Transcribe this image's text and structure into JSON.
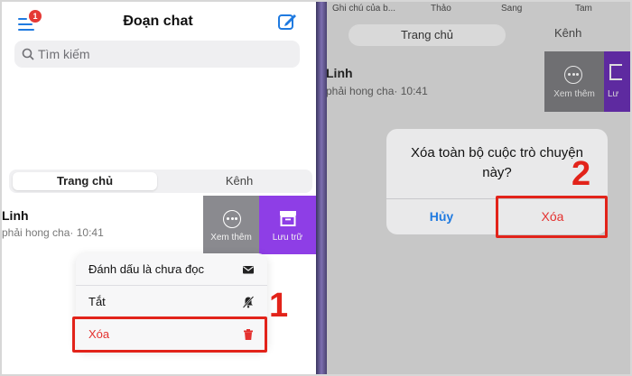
{
  "left": {
    "header": {
      "title": "Đoạn chat",
      "badge": "1"
    },
    "search": {
      "placeholder": "Tìm kiếm"
    },
    "tabs": {
      "active": "Trang chủ",
      "other": "Kênh"
    },
    "chat": {
      "name": "Linh",
      "preview": "phải hong cha· 10:41"
    },
    "swipe_actions": {
      "more": "Xem thêm",
      "archive": "Lưu trữ"
    },
    "context_menu": {
      "mark_unread": "Đánh dấu là chưa đọc",
      "mute": "Tắt",
      "delete": "Xóa"
    },
    "step_label": "1"
  },
  "right": {
    "top_names": [
      "Ghi chú của b...",
      "Thảo",
      "Sang",
      "Tam"
    ],
    "tabs": {
      "active": "Trang chủ",
      "other": "Kênh"
    },
    "chat": {
      "name": "Linh",
      "preview": "phải hong cha· 10:41"
    },
    "swipe_actions": {
      "more": "Xem thêm",
      "archive": "Lư"
    },
    "dialog": {
      "message": "Xóa toàn bộ cuộc trò chuyện này?",
      "cancel": "Hủy",
      "confirm": "Xóa"
    },
    "step_label": "2"
  },
  "colors": {
    "accent_blue": "#1f7ae0",
    "delete_red": "#e4312f",
    "highlight_red": "#e2231a",
    "archive_purple": "#8e3ee6",
    "more_gray": "#8a8a8f"
  },
  "icons": {
    "menu": "menu-icon",
    "compose": "compose-icon",
    "search": "search-icon",
    "more": "more-dots-icon",
    "archive": "archive-icon",
    "mark_unread": "envelope-icon",
    "mute": "bell-slash-icon",
    "delete": "trash-icon"
  }
}
